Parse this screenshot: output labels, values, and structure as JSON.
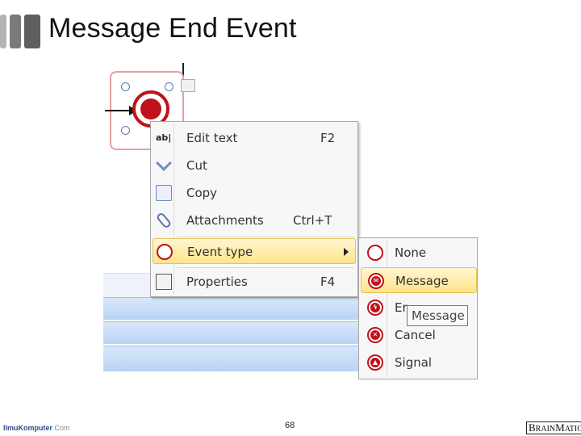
{
  "slide": {
    "title": "Message End Event",
    "page_number": "68",
    "footer_left": "IlmuKomputer",
    "footer_left_domain": ".Com",
    "logo_b": "B",
    "logo_rain": "RAIN",
    "logo_m": "M",
    "logo_atics": "ATICS"
  },
  "colors": {
    "event_red": "#c0121b",
    "highlight": "#ffe48a",
    "band_blue": "#b9d3f4"
  },
  "context_menu": {
    "items": [
      {
        "label": "Edit text",
        "shortcut": "F2",
        "icon": "edit-text-icon"
      },
      {
        "label": "Cut",
        "shortcut": "",
        "icon": "scissors-icon"
      },
      {
        "label": "Copy",
        "shortcut": "",
        "icon": "copy-icon"
      },
      {
        "label": "Attachments",
        "shortcut": "Ctrl+T",
        "icon": "paperclip-icon"
      },
      {
        "label": "Event type",
        "shortcut": "",
        "icon": "event-ring-icon"
      },
      {
        "label": "Properties",
        "shortcut": "F4",
        "icon": "properties-icon"
      }
    ],
    "highlighted": "Event type"
  },
  "submenu": {
    "items": [
      {
        "label": "None",
        "icon": "empty-circle-icon"
      },
      {
        "label": "Message",
        "icon": "envelope-circle-icon"
      },
      {
        "label": "Er",
        "icon": "error-circle-icon"
      },
      {
        "label": "Cancel",
        "icon": "cancel-circle-icon"
      },
      {
        "label": "Signal",
        "icon": "signal-circle-icon"
      }
    ],
    "highlighted": "Message"
  },
  "tooltip": {
    "text": "Message"
  }
}
